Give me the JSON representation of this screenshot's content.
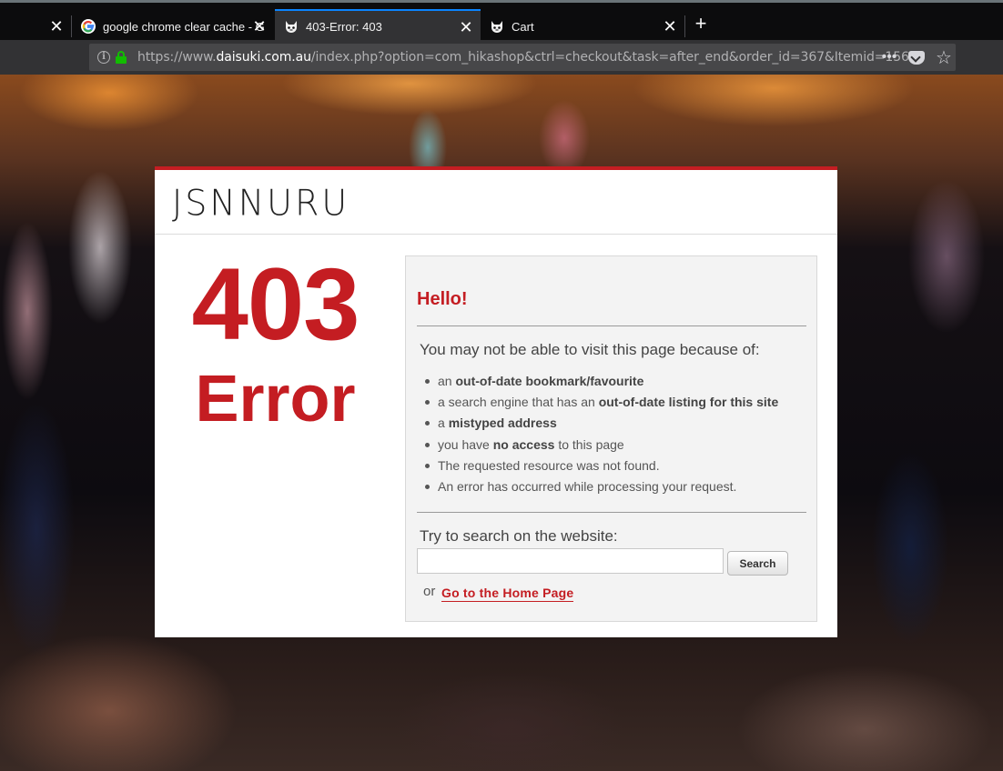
{
  "browser": {
    "tabs": [
      {
        "title": "",
        "icon": "blank-icon",
        "active": false
      },
      {
        "title": "google chrome clear cache - G",
        "icon": "google-icon",
        "active": false
      },
      {
        "title": "403-Error: 403",
        "icon": "site-favicon-icon",
        "active": true
      },
      {
        "title": "Cart",
        "icon": "site-favicon-icon",
        "active": false
      }
    ],
    "url_prefix": "https://www.",
    "url_domain": "daisuki.com.au",
    "url_path": "/index.php?option=com_hikashop&ctrl=checkout&task=after_end&order_id=367&Itemid=1560",
    "more_label": "•••",
    "star_label": "☆",
    "new_tab_label": "+",
    "close_label": "✕"
  },
  "site": {
    "logo": "JSNNURU"
  },
  "error": {
    "code": "403",
    "word": "Error",
    "greeting": "Hello!",
    "reasons_title": "You may not be able to visit this page because of:",
    "reasons": [
      {
        "before": "an ",
        "bold": "out-of-date bookmark/favourite",
        "after": ""
      },
      {
        "before": "a search engine that has an ",
        "bold": "out-of-date listing for this site",
        "after": ""
      },
      {
        "before": "a ",
        "bold": "mistyped address",
        "after": ""
      },
      {
        "before": "you have ",
        "bold": "no access",
        "after": " to this page"
      },
      {
        "before": "The requested resource was not found.",
        "bold": "",
        "after": ""
      },
      {
        "before": "An error has occurred while processing your request.",
        "bold": "",
        "after": ""
      }
    ],
    "search_title": "Try to search on the website:",
    "search_value": "",
    "search_button": "Search",
    "or_text": "or",
    "home_link": "Go to the Home Page"
  },
  "colors": {
    "accent_red": "#c41d22",
    "active_tab_indicator": "#0a84ff",
    "secure_lock": "#12bc00"
  }
}
